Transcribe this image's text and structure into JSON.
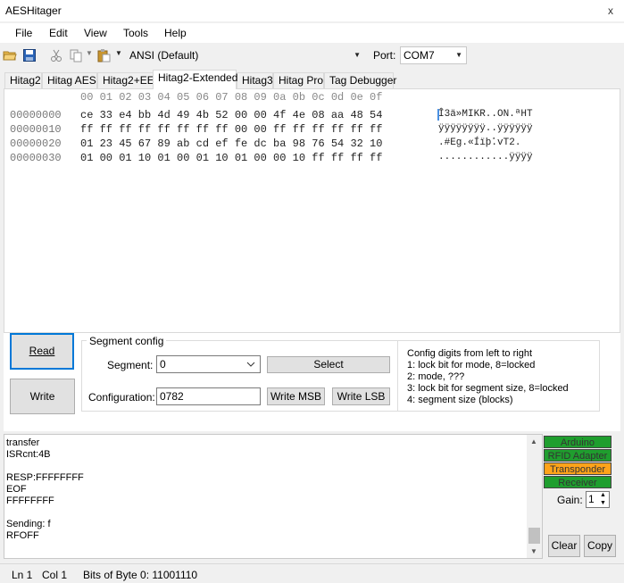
{
  "window": {
    "title": "AESHitager",
    "close_glyph": "x"
  },
  "menu": [
    "File",
    "Edit",
    "View",
    "Tools",
    "Help"
  ],
  "toolbar": {
    "encoding": "ANSI (Default)",
    "port_label": "Port:",
    "port_value": "COM7",
    "icons": [
      "open-folder-icon",
      "save-icon",
      "cut-icon",
      "copy-icon",
      "paste-icon"
    ]
  },
  "tabs": [
    "Hitag2",
    "Hitag AES",
    "Hitag2+EE",
    "Hitag2-Extended",
    "Hitag3",
    "Hitag Pro",
    "Tag Debugger"
  ],
  "active_tab": "Hitag2-Extended",
  "hex": {
    "header": "00 01 02 03 04 05 06 07 08 09 0a 0b 0c 0d 0e 0f",
    "rows": [
      {
        "addr": "00000000",
        "bytes": "ce 33 e4 bb 4d 49 4b 52 00 00 4f 4e 08 aa 48 54",
        "ascii": "Î3ä»MIKR..ON.ªHT"
      },
      {
        "addr": "00000010",
        "bytes": "ff ff ff ff ff ff ff ff 00 00 ff ff ff ff ff ff",
        "ascii": "ÿÿÿÿÿÿÿÿ..ÿÿÿÿÿÿ"
      },
      {
        "addr": "00000020",
        "bytes": "01 23 45 67 89 ab cd ef fe dc ba 98 76 54 32 10",
        "ascii": ".#Eg.«Íïþܺ.vT2."
      },
      {
        "addr": "00000030",
        "bytes": "01 00 01 10 01 00 01 10 01 00 00 10 ff ff ff ff",
        "ascii": "............ÿÿÿÿ"
      }
    ]
  },
  "buttons": {
    "read": "Read",
    "write": "Write",
    "select": "Select",
    "write_msb": "Write MSB",
    "write_lsb": "Write LSB",
    "clear": "Clear",
    "copy": "Copy"
  },
  "segment_config": {
    "title": "Segment config",
    "segment_label": "Segment:",
    "segment_value": "0",
    "configuration_label": "Configuration:",
    "configuration_value": "0782",
    "help": [
      "Config digits from left to right",
      "1: lock bit for mode, 8=locked",
      "2: mode, ???",
      "3: lock bit for segment size, 8=locked",
      "4: segment size (blocks)"
    ]
  },
  "log": [
    "transfer",
    "ISRcnt:4B",
    "",
    "RESP:FFFFFFFF",
    "EOF",
    "FFFFFFFF",
    "",
    "Sending: f",
    "RFOFF"
  ],
  "status_indicators": [
    {
      "label": "Arduino",
      "color": "#1f9e2e"
    },
    {
      "label": "RFID Adapter",
      "color": "#1f9e2e"
    },
    {
      "label": "Transponder",
      "color": "#ffa31a"
    },
    {
      "label": "Receiver",
      "color": "#1f9e2e"
    }
  ],
  "gain": {
    "label": "Gain:",
    "value": "1"
  },
  "statusbar": {
    "line": "Ln 1",
    "col": "Col 1",
    "bits": "Bits of Byte 0: 11001110"
  }
}
